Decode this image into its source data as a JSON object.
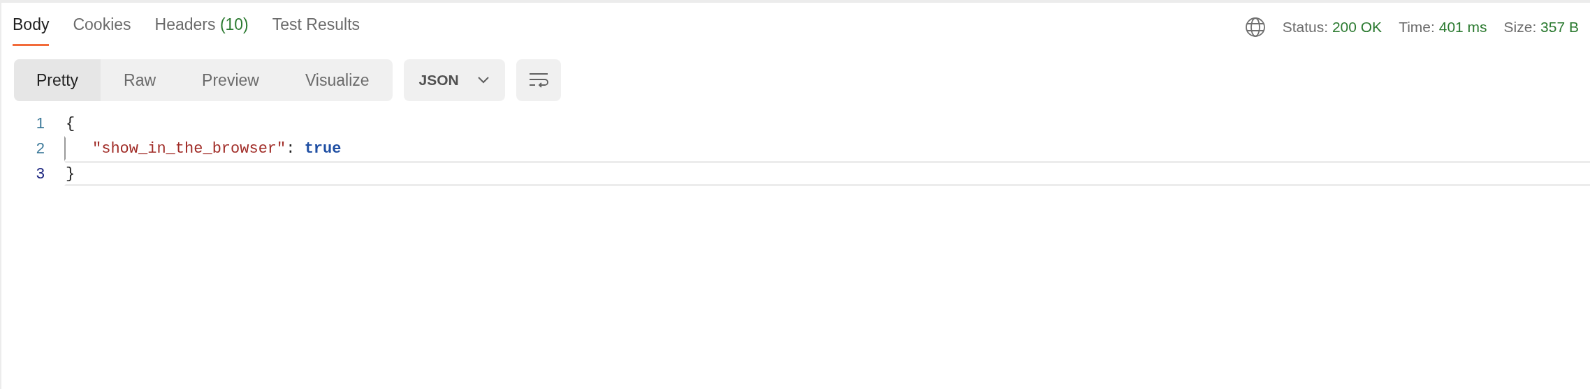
{
  "tabs": [
    {
      "label": "Body",
      "selected": true
    },
    {
      "label": "Cookies",
      "selected": false
    },
    {
      "label": "Headers",
      "count": "(10)",
      "selected": false
    },
    {
      "label": "Test Results",
      "selected": false
    }
  ],
  "status": [
    {
      "label": "Status:",
      "value": "200 OK"
    },
    {
      "label": "Time:",
      "value": "401 ms"
    },
    {
      "label": "Size:",
      "value": "357 B"
    }
  ],
  "view_modes": [
    {
      "label": "Pretty",
      "selected": true
    },
    {
      "label": "Raw",
      "selected": false
    },
    {
      "label": "Preview",
      "selected": false
    },
    {
      "label": "Visualize",
      "selected": false
    }
  ],
  "format": "JSON",
  "code_lines": [
    {
      "number": "1",
      "active": false,
      "indented": false,
      "tokens": [
        {
          "kind": "punct",
          "text": "{"
        }
      ]
    },
    {
      "number": "2",
      "active": false,
      "indented": true,
      "tokens": [
        {
          "kind": "key",
          "text": "\"show_in_the_browser\""
        },
        {
          "kind": "punct",
          "text": ": "
        },
        {
          "kind": "bool",
          "text": "true"
        }
      ]
    },
    {
      "number": "3",
      "active": true,
      "indented": false,
      "tokens": [
        {
          "kind": "punct",
          "text": "}"
        }
      ]
    }
  ]
}
